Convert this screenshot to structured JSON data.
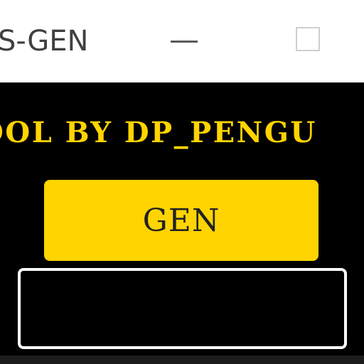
{
  "window": {
    "title": "S-GEN"
  },
  "main": {
    "credit_text": "OOL BY DP_PENGU",
    "gen_button_label": "GEN",
    "output_value": ""
  }
}
